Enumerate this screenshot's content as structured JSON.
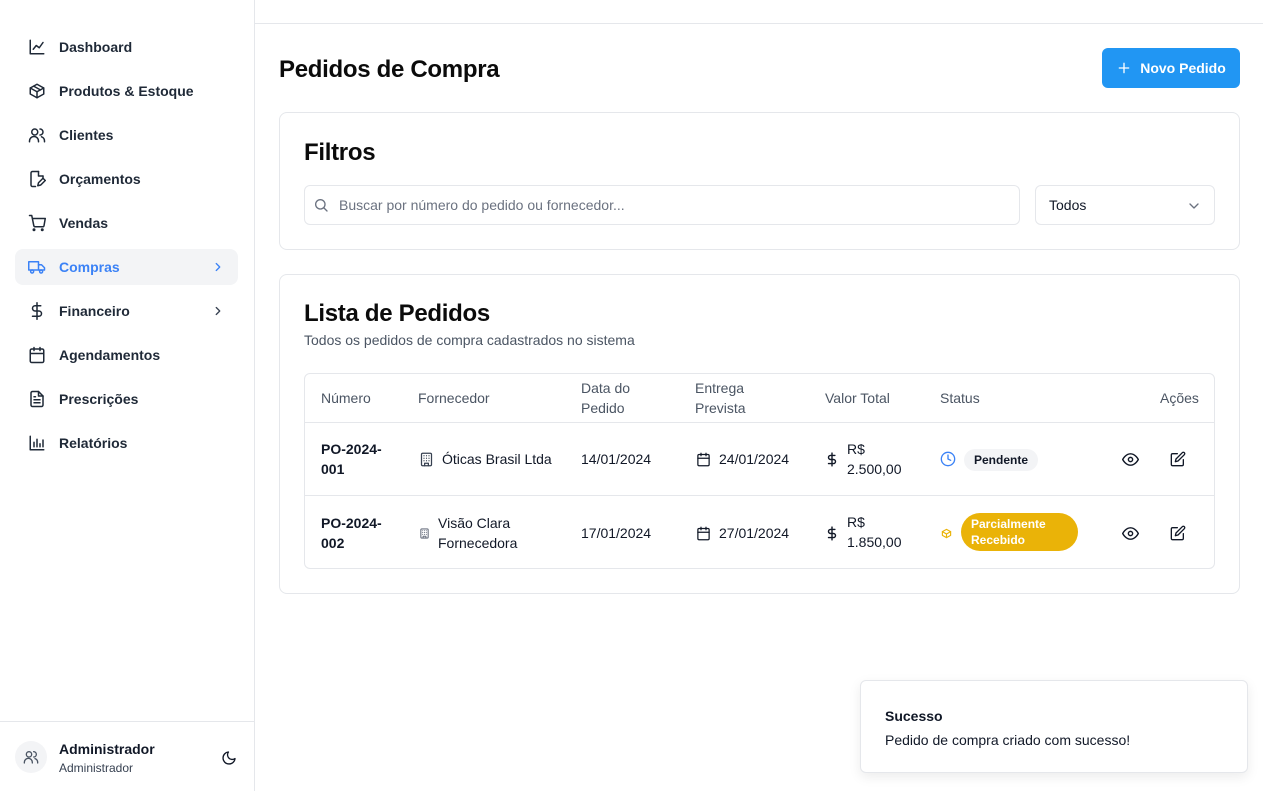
{
  "sidebar": {
    "items": [
      {
        "label": "Dashboard",
        "icon": "chart-line-icon"
      },
      {
        "label": "Produtos & Estoque",
        "icon": "package-icon"
      },
      {
        "label": "Clientes",
        "icon": "users-icon"
      },
      {
        "label": "Orçamentos",
        "icon": "file-edit-icon"
      },
      {
        "label": "Vendas",
        "icon": "cart-icon"
      },
      {
        "label": "Compras",
        "icon": "truck-icon",
        "active": true
      },
      {
        "label": "Financeiro",
        "icon": "dollar-icon"
      },
      {
        "label": "Agendamentos",
        "icon": "calendar-icon"
      },
      {
        "label": "Prescrições",
        "icon": "file-text-icon"
      },
      {
        "label": "Relatórios",
        "icon": "bar-chart-icon"
      }
    ],
    "user": {
      "name": "Administrador",
      "role": "Administrador"
    }
  },
  "page": {
    "title": "Pedidos de Compra",
    "new_button": "Novo Pedido"
  },
  "filters": {
    "title": "Filtros",
    "search_placeholder": "Buscar por número do pedido ou fornecedor...",
    "status_selected": "Todos"
  },
  "list": {
    "title": "Lista de Pedidos",
    "subtitle": "Todos os pedidos de compra cadastrados no sistema",
    "columns": {
      "numero": "Número",
      "fornecedor": "Fornecedor",
      "data_l1": "Data do",
      "data_l2": "Pedido",
      "entrega_l1": "Entrega",
      "entrega_l2": "Prevista",
      "valor": "Valor Total",
      "status": "Status",
      "acoes": "Ações"
    },
    "rows": [
      {
        "numero_l1": "PO-2024-",
        "numero_l2": "001",
        "fornecedor_l1": "Óticas Brasil Ltda",
        "fornecedor_l2": "",
        "data": "14/01/2024",
        "entrega": "24/01/2024",
        "valor_l1": "R$",
        "valor_l2": "2.500,00",
        "status_l1": "Pendente",
        "status_l2": ""
      },
      {
        "numero_l1": "PO-2024-",
        "numero_l2": "002",
        "fornecedor_l1": "Visão Clara",
        "fornecedor_l2": "Fornecedora",
        "data": "17/01/2024",
        "entrega": "27/01/2024",
        "valor_l1": "R$",
        "valor_l2": "1.850,00",
        "status_l1": "Parcialmente",
        "status_l2": "Recebido"
      }
    ]
  },
  "toast": {
    "title": "Sucesso",
    "message": "Pedido de compra criado com sucesso!"
  },
  "colors": {
    "accent": "#2196f3",
    "active_nav": "#3b82f6",
    "pending_icon": "#3b82f6",
    "partial_badge": "#eab308"
  }
}
